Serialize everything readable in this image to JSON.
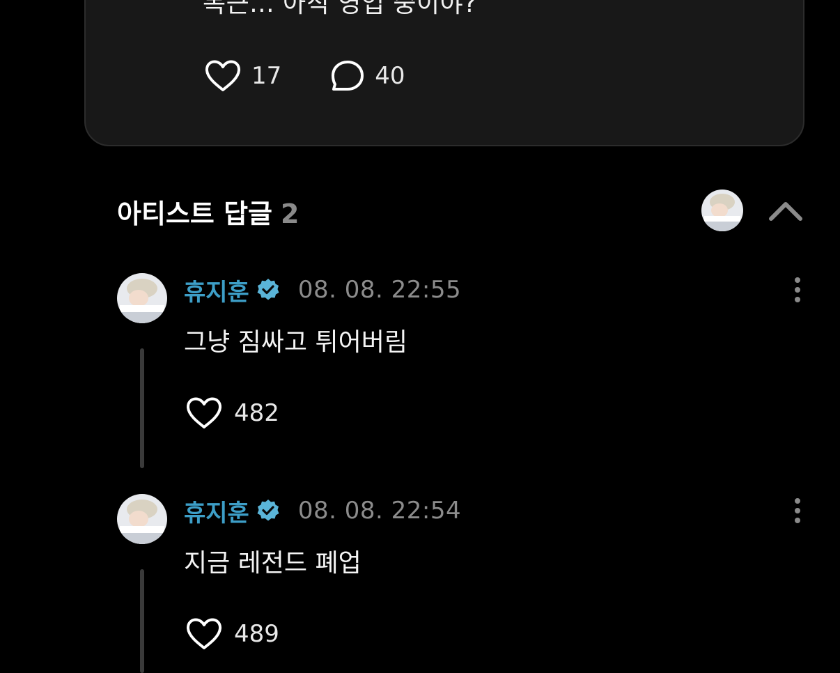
{
  "post": {
    "text": "복근... 아직 영업 중이야?",
    "likes": "17",
    "comments": "40"
  },
  "artist_replies": {
    "title": "아티스트 답글",
    "count": "2"
  },
  "replies": [
    {
      "author": "휴지훈",
      "timestamp": "08. 08. 22:55",
      "text": "그냥 짐싸고 튀어버림",
      "likes": "482"
    },
    {
      "author": "휴지훈",
      "timestamp": "08. 08. 22:54",
      "text": "지금 레전드 폐업",
      "likes": "489"
    }
  ],
  "colors": {
    "background": "#000000",
    "card": "#181818",
    "author_name": "#3d9ec7",
    "verified_badge": "#5ab4d8",
    "muted_text": "#8c8c8c"
  },
  "icons": {
    "like": "heart-outline-icon",
    "comment": "speech-bubble-icon",
    "verified": "verified-badge-icon",
    "more": "vertical-dots-icon",
    "collapse": "chevron-up-icon"
  }
}
